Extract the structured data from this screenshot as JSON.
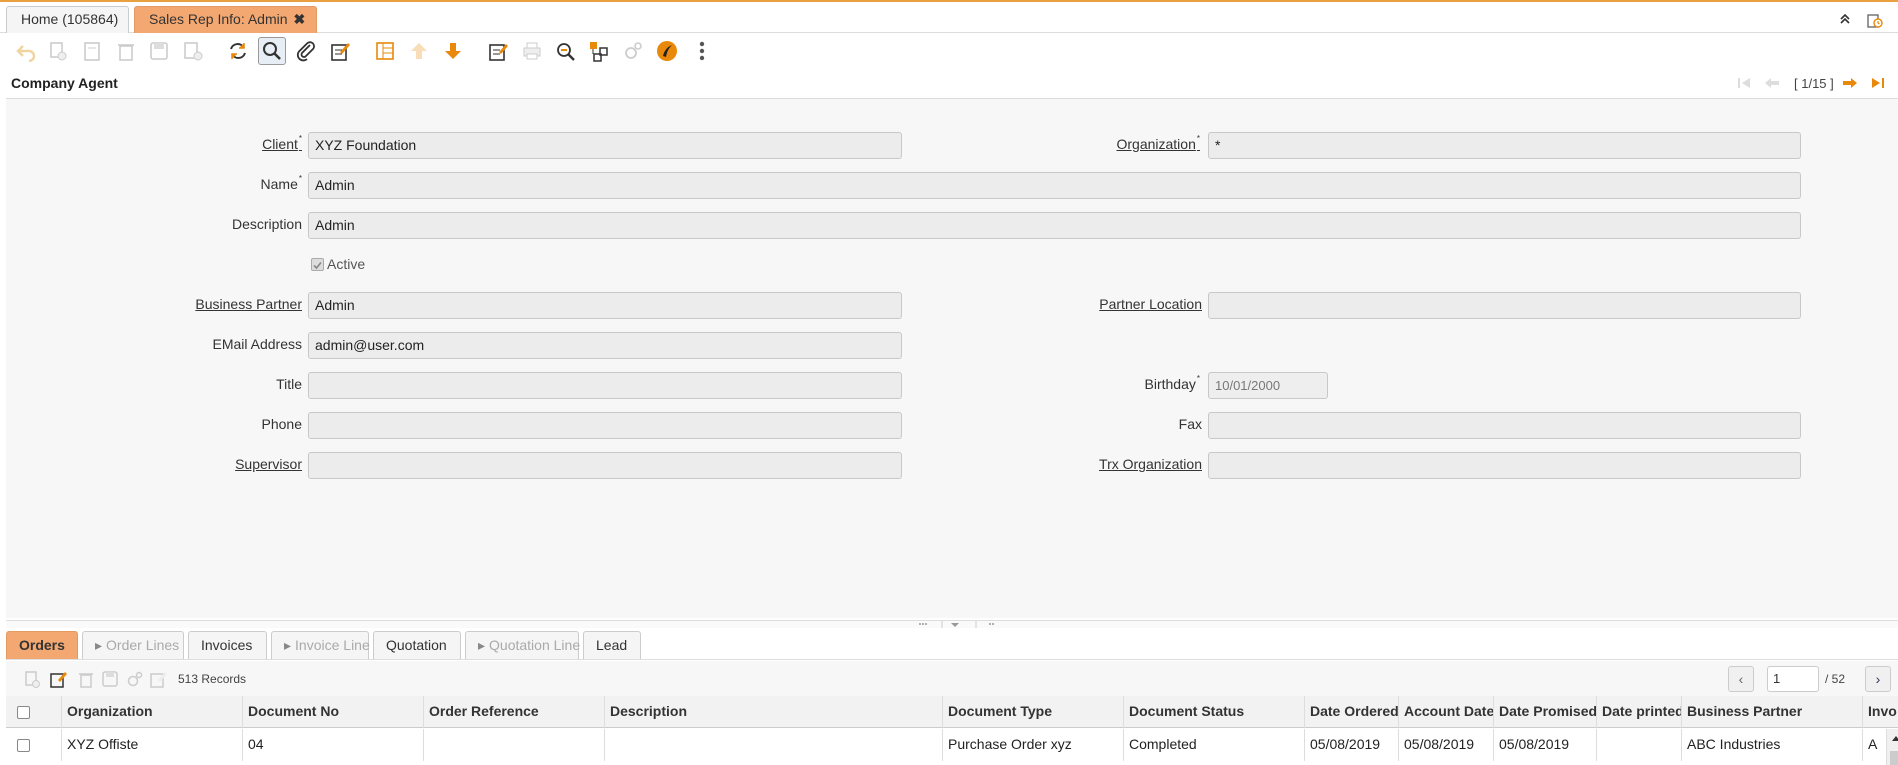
{
  "window_tabs": [
    {
      "label": "Home (105864)"
    },
    {
      "label": "Sales Rep Info: Admin",
      "close": "✖"
    }
  ],
  "toolbar": {
    "icons": [
      "undo-icon",
      "copy-icon",
      "new-icon",
      "delete-icon",
      "save-icon",
      "save-new-icon",
      "refresh-icon",
      "find-icon",
      "attachment-icon",
      "edit-icon",
      "grid-toggle-icon",
      "parent-record-icon",
      "detail-record-icon",
      "report-icon",
      "print-icon",
      "zoom-icon",
      "active-workflows-icon",
      "requests-icon",
      "product-info-icon",
      "more-icon"
    ]
  },
  "detail": {
    "title": "Company Agent",
    "record_position": "[ 1/15 ]"
  },
  "form": {
    "client_label": "Client",
    "client_value": "XYZ Foundation",
    "organization_label": "Organization",
    "organization_value": "*",
    "name_label": "Name",
    "name_value": "Admin",
    "description_label": "Description",
    "description_value": "Admin",
    "active_label": "Active",
    "business_partner_label": "Business Partner",
    "business_partner_value": "Admin",
    "partner_location_label": "Partner Location",
    "partner_location_value": "",
    "email_label": "EMail Address",
    "email_value": "admin@user.com",
    "title_label": "Title",
    "title_value": "",
    "birthday_label": "Birthday",
    "birthday_value": "10/01/2000",
    "phone_label": "Phone",
    "phone_value": "",
    "fax_label": "Fax",
    "fax_value": "",
    "supervisor_label": "Supervisor",
    "supervisor_value": "",
    "trx_org_label": "Trx Organization",
    "trx_org_value": ""
  },
  "detail_tabs": [
    {
      "label": "Orders",
      "active": true
    },
    {
      "label": "Order Lines"
    },
    {
      "label": "Invoices"
    },
    {
      "label": "Invoice Line"
    },
    {
      "label": "Quotation"
    },
    {
      "label": "Quotation Line"
    },
    {
      "label": "Lead"
    }
  ],
  "grid": {
    "records": "513 Records",
    "page": "1",
    "total_pages": "/ 52",
    "columns": [
      "Organization",
      "Document No",
      "Order Reference",
      "Description",
      "Document Type",
      "Document Status",
      "Date Ordered",
      "Account Date",
      "Date Promised",
      "Date printed",
      "Business Partner",
      "Invo"
    ],
    "rows": [
      [
        "XYZ Offiste",
        "04",
        "",
        "",
        "Purchase Order xyz",
        "Completed",
        "05/08/2019",
        "05/08/2019",
        "05/08/2019",
        "",
        "ABC Industries",
        "A"
      ]
    ]
  },
  "colors": {
    "accent_tab": "#f4a871",
    "toolbar_orange": "#e8890c",
    "form_bg": "#f7f7f7"
  }
}
